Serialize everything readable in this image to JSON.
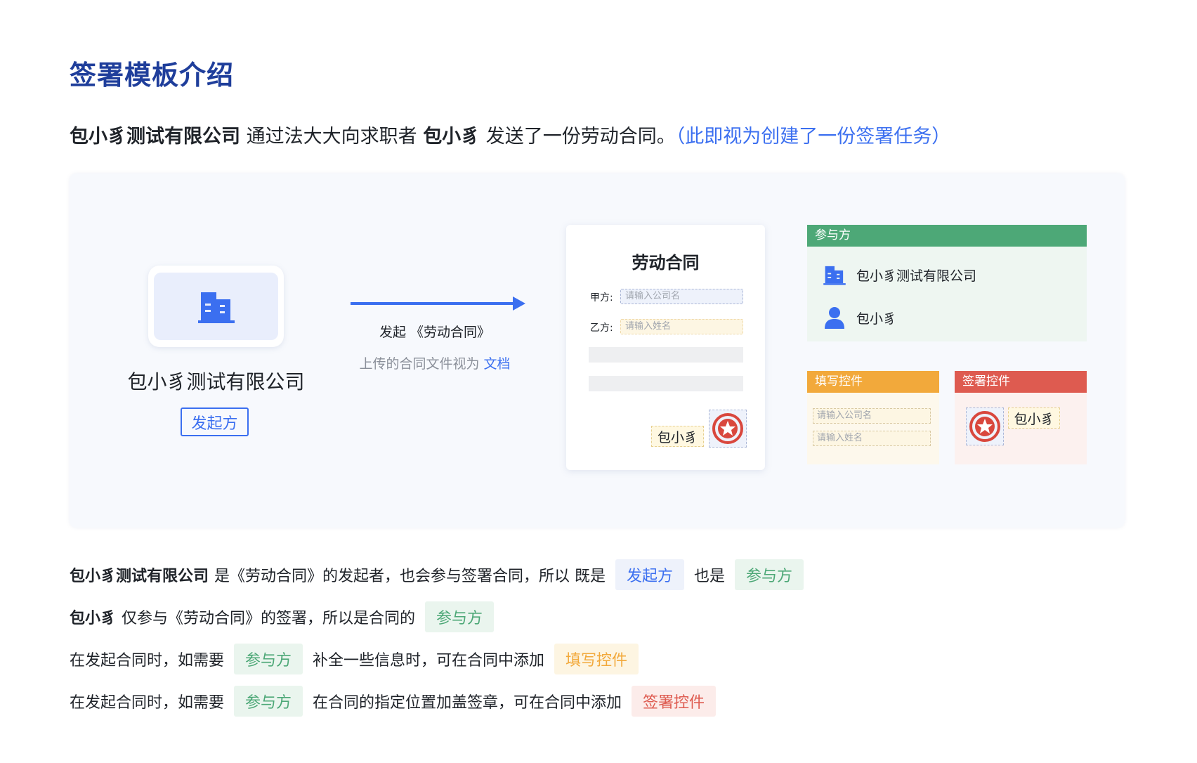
{
  "title": "签署模板介绍",
  "intro": {
    "company": "包小豸测试有限公司",
    "mid": "通过法大大向求职者",
    "person": "包小豸",
    "tail": "发送了一份劳动合同。",
    "note": "（此即视为创建了一份签署任务）"
  },
  "diagram": {
    "company_name": "包小豸测试有限公司",
    "initiator_tag": "发起方",
    "arrow_label": "发起 《劳动合同》",
    "arrow_sub": "上传的合同文件视为",
    "arrow_sub_link": "文档",
    "doc": {
      "title": "劳动合同",
      "party_a_label": "甲方:",
      "party_a_placeholder": "请输入公司名",
      "party_b_label": "乙方:",
      "party_b_placeholder": "请输入姓名",
      "signature": "包小豸"
    },
    "participants": {
      "header": "参与方",
      "items": [
        "包小豸测试有限公司",
        "包小豸"
      ]
    },
    "fill_controls": {
      "header": "填写控件",
      "fields": [
        "请输入公司名",
        "请输入姓名"
      ]
    },
    "sign_controls": {
      "header": "签署控件",
      "signature": "包小豸"
    }
  },
  "lines": [
    {
      "bold": "包小豸测试有限公司",
      "text1": "是《劳动合同》的发起者，也会参与签署合同，所以 既是",
      "chip1": "发起方",
      "text2": "也是",
      "chip2": "参与方"
    },
    {
      "bold": "包小豸",
      "text1": "仅参与《劳动合同》的签署，所以是合同的",
      "chip1": "参与方"
    },
    {
      "text1": "在发起合同时，如需要",
      "chip1": "参与方",
      "text2": "补全一些信息时，可在合同中添加",
      "chip2": "填写控件"
    },
    {
      "text1": "在发起合同时，如需要",
      "chip1": "参与方",
      "text2": "在合同的指定位置加盖签章，可在合同中添加",
      "chip2": "签署控件"
    }
  ],
  "colors": {
    "title": "#1f3e9b",
    "accent_blue": "#3b6ff0",
    "participant_green": "#4da877",
    "fill_yellow": "#f2a93b",
    "sign_red": "#de5b50"
  },
  "icons": {
    "company": "building-icon",
    "person": "person-icon",
    "seal": "red-seal-icon"
  }
}
